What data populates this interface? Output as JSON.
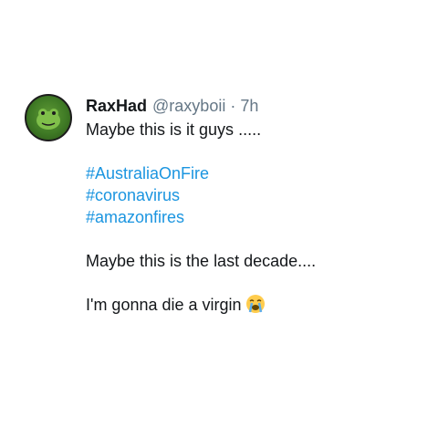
{
  "tweet": {
    "display_name": "RaxHad",
    "handle": "@raxyboii",
    "separator": "·",
    "time": "7h",
    "line1": "Maybe this is it guys .....",
    "hashtags": [
      "#AustraliaOnFire",
      "#coronavirus",
      "#amazonfires"
    ],
    "line2": "Maybe this is the last decade....",
    "line3": "I'm gonna die a virgin"
  },
  "avatar": {
    "icon": "frog-avatar-icon"
  },
  "emoji": {
    "icon": "loudly-crying-face-icon"
  },
  "colors": {
    "text": "#14171a",
    "muted": "#657786",
    "link": "#1b95e0",
    "avatar_green": "#3f7a25"
  }
}
